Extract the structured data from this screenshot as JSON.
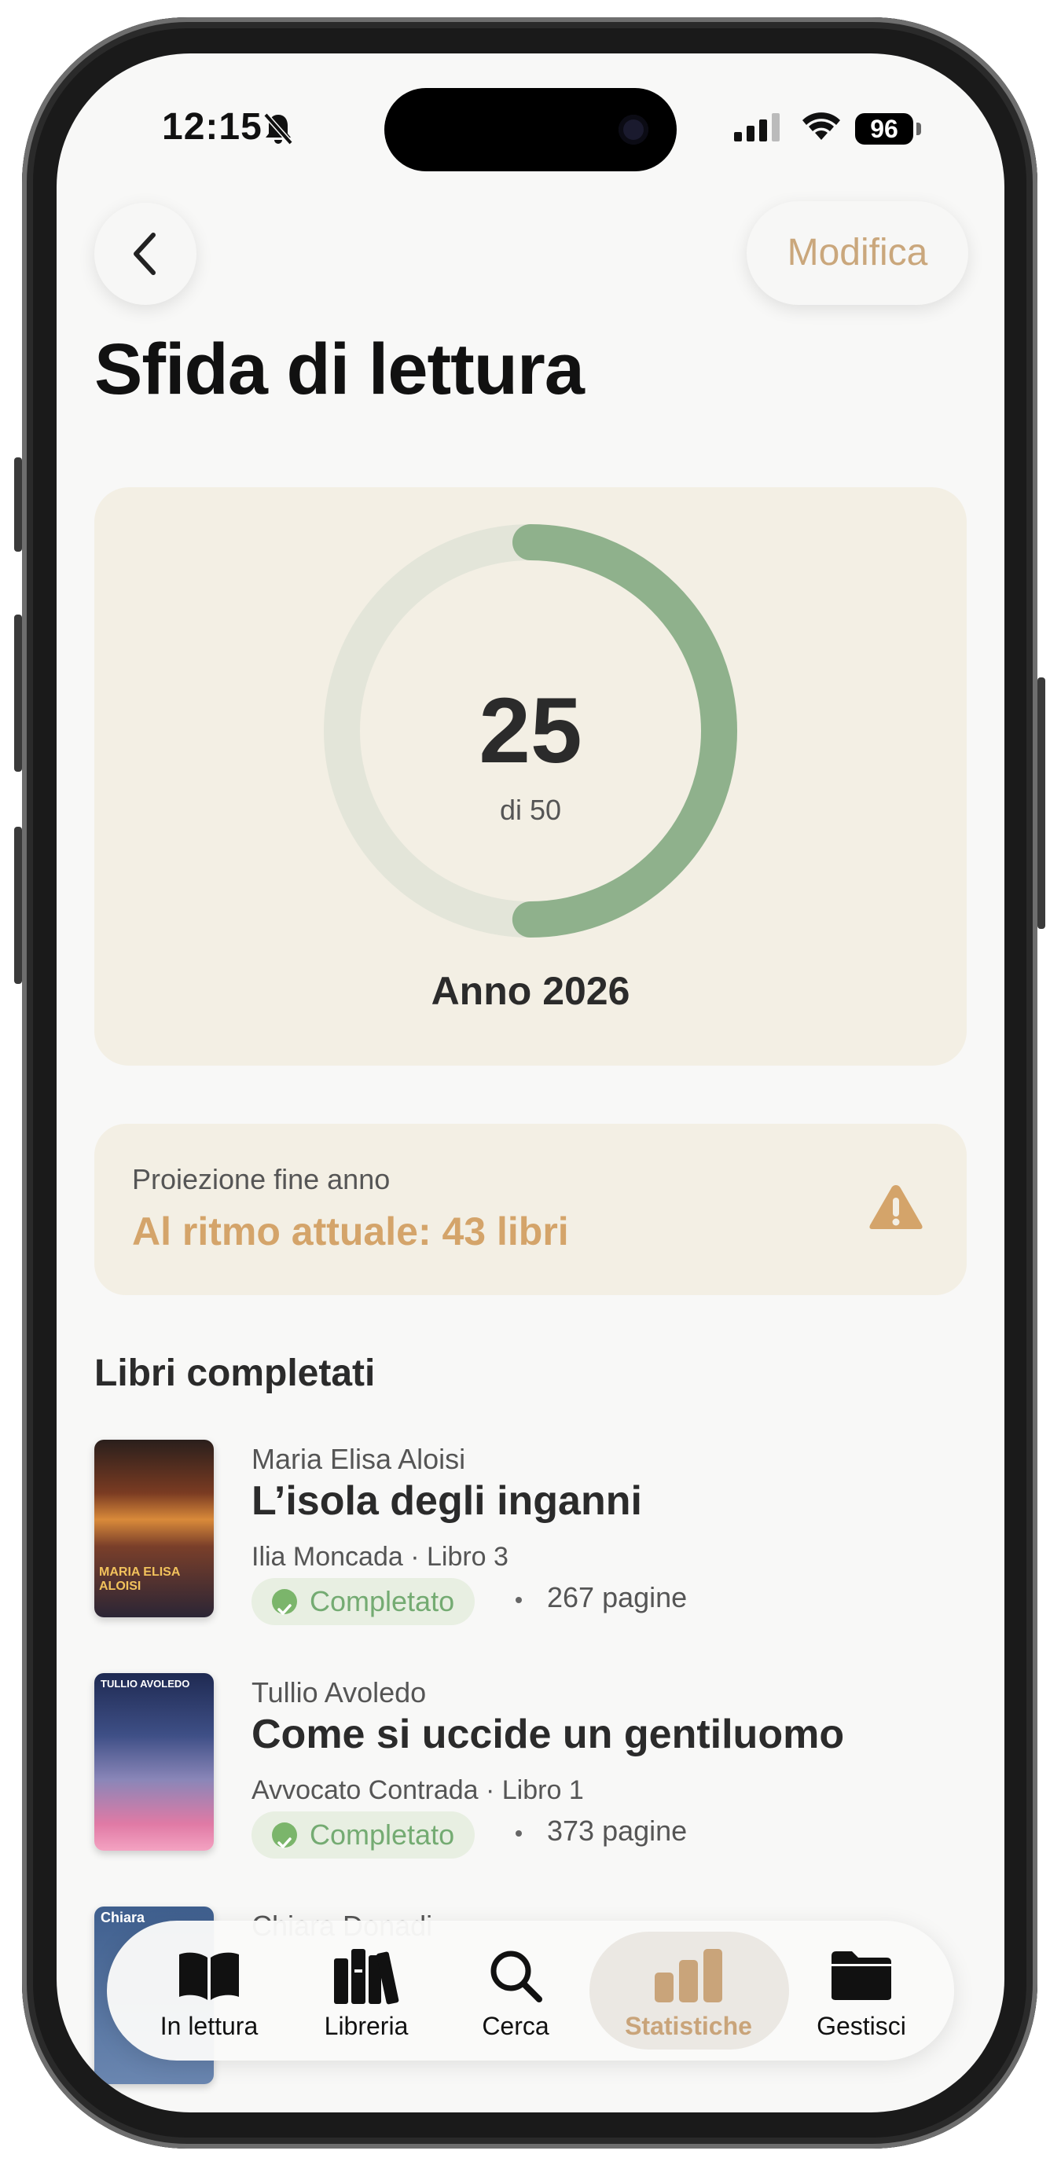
{
  "status_bar": {
    "time": "12:15",
    "battery": "96"
  },
  "header": {
    "back_icon": "chevron-left-icon",
    "edit_label": "Modifica",
    "title": "Sfida di lettura"
  },
  "challenge": {
    "read": 25,
    "read_label": "25",
    "goal_label": "di 50",
    "goal": 50,
    "progress": 0.5,
    "year_label": "Anno 2026",
    "colors": {
      "track": "#e3e5d9",
      "progress": "#8fb18c"
    }
  },
  "projection": {
    "label": "Proiezione fine anno",
    "value": "Al ritmo attuale: 43 libri",
    "icon": "warning-icon"
  },
  "completed": {
    "section_title": "Libri completati",
    "books": [
      {
        "author": "Maria Elisa Aloisi",
        "title": "L’isola degli inganni",
        "series": "Ilia Moncada · Libro 3",
        "status": "Completato",
        "pages": "267 pagine",
        "cover_text": "MARIA ELISA ALOISI"
      },
      {
        "author": "Tullio Avoledo",
        "title": "Come si uccide un gentiluomo",
        "series": "Avvocato Contrada · Libro 1",
        "status": "Completato",
        "pages": "373 pagine",
        "cover_text": "TULLIO AVOLEDO"
      },
      {
        "author": "Chiara Donadi",
        "cover_text": "Chiara"
      }
    ]
  },
  "tabbar": {
    "items": [
      {
        "label": "In lettura",
        "icon": "open-book-icon"
      },
      {
        "label": "Libreria",
        "icon": "books-shelf-icon"
      },
      {
        "label": "Cerca",
        "icon": "search-icon"
      },
      {
        "label": "Statistiche",
        "icon": "bar-chart-icon",
        "active": true
      },
      {
        "label": "Gestisci",
        "icon": "folder-icon"
      }
    ]
  }
}
